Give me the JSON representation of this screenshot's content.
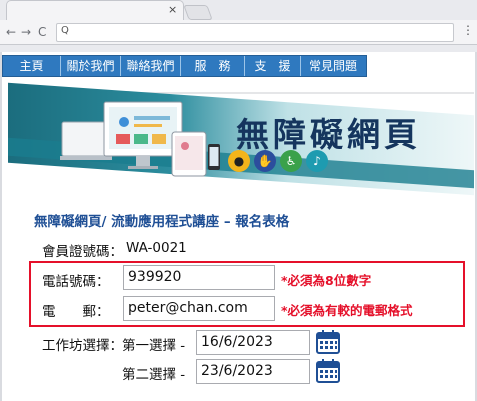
{
  "browser": {
    "close_glyph": "×",
    "back_glyph": "←",
    "forward_glyph": "→",
    "reload_glyph": "C",
    "search_glyph": "Q",
    "menu_glyph": "⋮"
  },
  "nav": {
    "items": [
      "主頁",
      "關於我們",
      "聯絡我們",
      "服　務",
      "支　援",
      "常見問題"
    ]
  },
  "banner": {
    "title": "無障礙網頁",
    "icons": [
      "eye-icon",
      "sign-language-icon",
      "wheelchair-icon",
      "hearing-icon"
    ]
  },
  "form": {
    "title": "無障礙網頁/ 流動應用程式講座 – 報名表格",
    "member_label": "會員證號碼：",
    "member_value": "WA-0021",
    "phone_label": "電話號碼：",
    "phone_value": "939920",
    "phone_warning": "*必須為8位數字",
    "email_label": "電　　郵：",
    "email_value": "peter@chan.com",
    "email_warning": "*必須為有較的電郵格式",
    "workshop_label": "工作坊選擇：",
    "first_choice_label": "第一選擇 -",
    "first_choice_value": "16/6/2023",
    "second_choice_label": "第二選擇 -",
    "second_choice_value": "23/6/2023"
  },
  "colors": {
    "nav_bg": "#2f79bf",
    "title_blue": "#1f4f95",
    "warning_red": "#e5102a",
    "banner_teal": "#1b6d7e"
  }
}
